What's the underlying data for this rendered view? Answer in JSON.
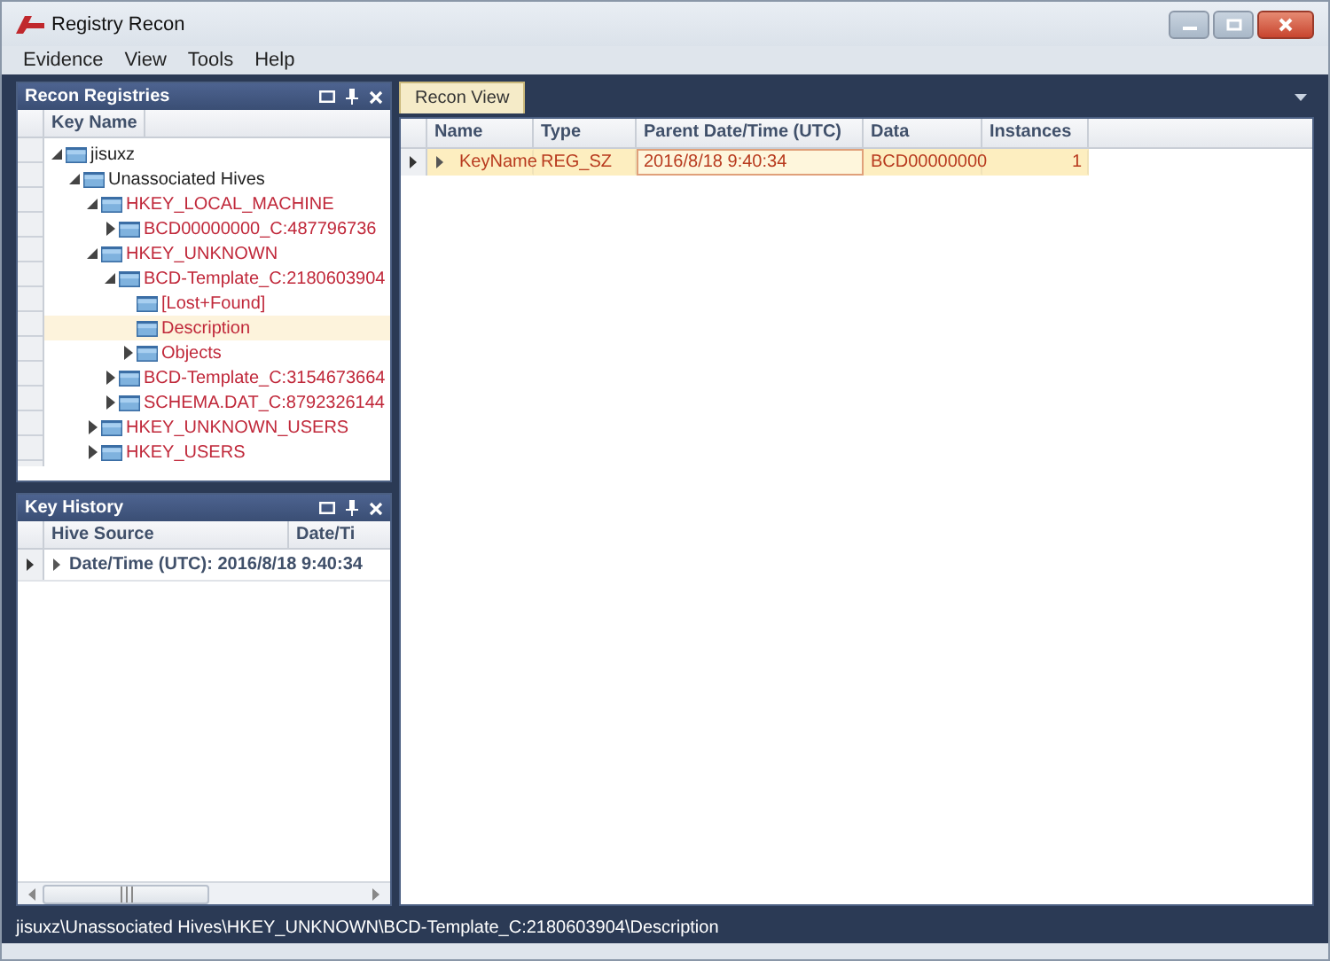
{
  "window": {
    "title": "Registry Recon"
  },
  "menu": [
    "Evidence",
    "View",
    "Tools",
    "Help"
  ],
  "registries_panel": {
    "title": "Recon Registries",
    "column": "Key Name",
    "tree": [
      {
        "label": "jisuxz",
        "kind": "group",
        "expanded": true,
        "selected": false,
        "children": [
          {
            "label": "Unassociated Hives",
            "kind": "group",
            "expanded": true,
            "selected": false,
            "children": [
              {
                "label": "HKEY_LOCAL_MACHINE",
                "kind": "key",
                "expanded": true,
                "selected": false,
                "children": [
                  {
                    "label": "BCD00000000_C:487796736",
                    "kind": "key",
                    "expanded": false,
                    "selected": false
                  }
                ]
              },
              {
                "label": "HKEY_UNKNOWN",
                "kind": "key",
                "expanded": true,
                "selected": false,
                "children": [
                  {
                    "label": "BCD-Template_C:2180603904",
                    "kind": "key",
                    "expanded": true,
                    "selected": false,
                    "children": [
                      {
                        "label": "[Lost+Found]",
                        "kind": "key",
                        "selected": false
                      },
                      {
                        "label": "Description",
                        "kind": "key",
                        "selected": true
                      },
                      {
                        "label": "Objects",
                        "kind": "key",
                        "expanded": false,
                        "selected": false
                      }
                    ]
                  },
                  {
                    "label": "BCD-Template_C:3154673664",
                    "kind": "key",
                    "expanded": false,
                    "selected": false
                  },
                  {
                    "label": "SCHEMA.DAT_C:8792326144",
                    "kind": "key",
                    "expanded": false,
                    "selected": false
                  }
                ]
              },
              {
                "label": "HKEY_UNKNOWN_USERS",
                "kind": "key",
                "expanded": false,
                "selected": false
              },
              {
                "label": "HKEY_USERS",
                "kind": "key",
                "expanded": false,
                "selected": false
              }
            ]
          }
        ]
      }
    ]
  },
  "history_panel": {
    "title": "Key History",
    "columns": [
      "Hive Source",
      "Date/Ti"
    ],
    "rows": [
      {
        "label": "Date/Time (UTC): 2016/8/18 9:40:34",
        "expanded": false
      }
    ]
  },
  "tabs": [
    {
      "label": "Recon View",
      "selected": true
    }
  ],
  "recon_table": {
    "columns": [
      "Name",
      "Type",
      "Parent Date/Time (UTC)",
      "Data",
      "Instances"
    ],
    "rows": [
      {
        "expanded": false,
        "selected": true,
        "cells": [
          {
            "text": "KeyName",
            "focused": false
          },
          {
            "text": "REG_SZ",
            "focused": false
          },
          {
            "text": "2016/8/18 9:40:34",
            "focused": true
          },
          {
            "text": "BCD00000000",
            "focused": false
          },
          {
            "text": "1",
            "focused": false
          }
        ]
      }
    ]
  },
  "status_bar": "jisuxz\\Unassociated Hives\\HKEY_UNKNOWN\\BCD-Template_C:2180603904\\Description"
}
